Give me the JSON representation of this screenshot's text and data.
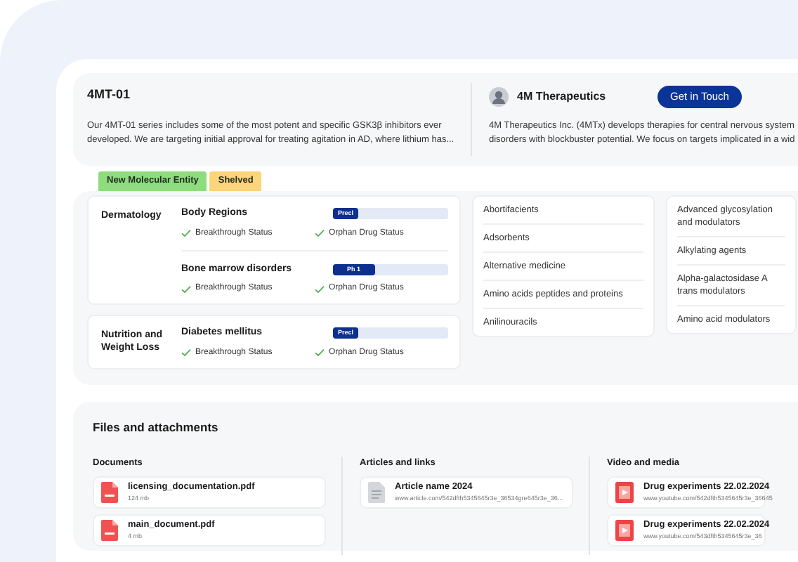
{
  "product": {
    "title": "4MT-01",
    "description": "Our 4MT-01 series includes some of the most potent and specific GSK3β inhibitors ever developed. We are targeting initial approval for treating agitation in AD, where lithium has..."
  },
  "company": {
    "name": "4M Therapeutics",
    "button": "Get in Touch",
    "description": "4M Therapeutics Inc. (4MTx) develops therapies for central nervous system disorders with blockbuster potential. We focus on targets implicated in a wid"
  },
  "tags": [
    {
      "label": "New Molecular Entity",
      "color": "#8fdc7f"
    },
    {
      "label": "Shelved",
      "color": "#fcd57a"
    }
  ],
  "areas": [
    {
      "name": "Dermatology",
      "indications": [
        {
          "name": "Body Regions",
          "stage": "Precl",
          "level": 0.22,
          "flags": [
            "Breakthrough Status",
            "Orphan Drug Status"
          ]
        },
        {
          "name": "Bone marrow disorders",
          "stage": "Ph 1",
          "level": 0.36,
          "flags": [
            "Breakthrough Status",
            "Orphan Drug Status"
          ]
        }
      ]
    },
    {
      "name": "Nutrition and Weight Loss",
      "indications": [
        {
          "name": "Diabetes mellitus",
          "stage": "Precl",
          "level": 0.22,
          "flags": [
            "Breakthrough Status",
            "Orphan Drug Status"
          ]
        }
      ]
    }
  ],
  "classes_column_1": [
    "Abortifacients",
    "Adsorbents",
    "Alternative medicine",
    "Amino acids peptides and proteins",
    "Anilinouracils"
  ],
  "classes_column_2": [
    "Advanced glycosylation and modulators",
    "Alkylating agents",
    "Alpha-galactosidase A trans modulators",
    "Amino acid modulators"
  ],
  "files": {
    "title": "Files and attachments",
    "groups": [
      {
        "kind": "document",
        "title": "Documents",
        "items": [
          {
            "name": "licensing_documentation.pdf",
            "detail": "124 mb"
          },
          {
            "name": "main_document.pdf",
            "detail": "4 mb"
          }
        ]
      },
      {
        "kind": "article",
        "title": "Articles and links",
        "items": [
          {
            "name": "Article name 2024",
            "detail": "www.article.com/542dfth5345645r3e_36534gre645r3e_36..."
          }
        ]
      },
      {
        "kind": "video",
        "title": "Video and media",
        "items": [
          {
            "name": "Drug experiments 22.02.2024",
            "detail": "www.youtube.com/542dfth5345645r3e_36645"
          },
          {
            "name": "Drug experiments 22.02.2024",
            "detail": "www.youtube.com/543dfth5345645r3e_36"
          }
        ]
      }
    ]
  }
}
